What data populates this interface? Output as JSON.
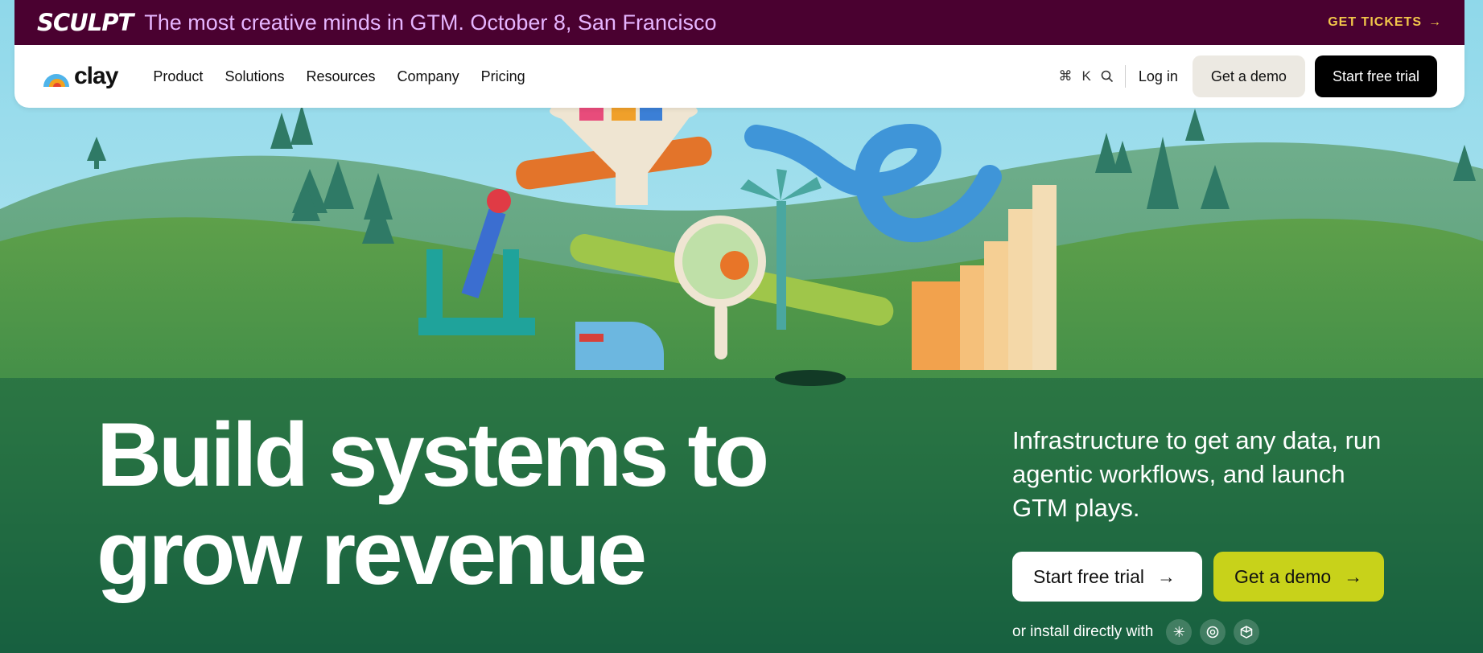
{
  "announcement": {
    "brand": "SCULPT",
    "message": "The most creative minds in GTM. October 8, San Francisco",
    "cta_label": "GET TICKETS",
    "cta_arrow": "→",
    "accent_color": "#f2c74a",
    "background_color": "#4a0130"
  },
  "nav": {
    "logo_text": "clay",
    "links": [
      "Product",
      "Solutions",
      "Resources",
      "Company",
      "Pricing"
    ],
    "shortcut_cmd": "⌘",
    "shortcut_key": "K",
    "search_icon": "search-icon",
    "login_label": "Log in",
    "demo_label": "Get a demo",
    "trial_label": "Start free trial"
  },
  "hero": {
    "title_line1": "Build systems to",
    "title_line2": "grow revenue",
    "subtitle": "Infrastructure to get any data, run agentic workflows, and launch GTM plays.",
    "cta_trial_label": "Start free trial",
    "cta_demo_label": "Get a demo",
    "cta_arrow": "→",
    "install_text": "or install directly with",
    "install_icons": [
      "claude-icon",
      "openai-icon",
      "cube-icon"
    ],
    "demo_button_color": "#c8d21a"
  }
}
